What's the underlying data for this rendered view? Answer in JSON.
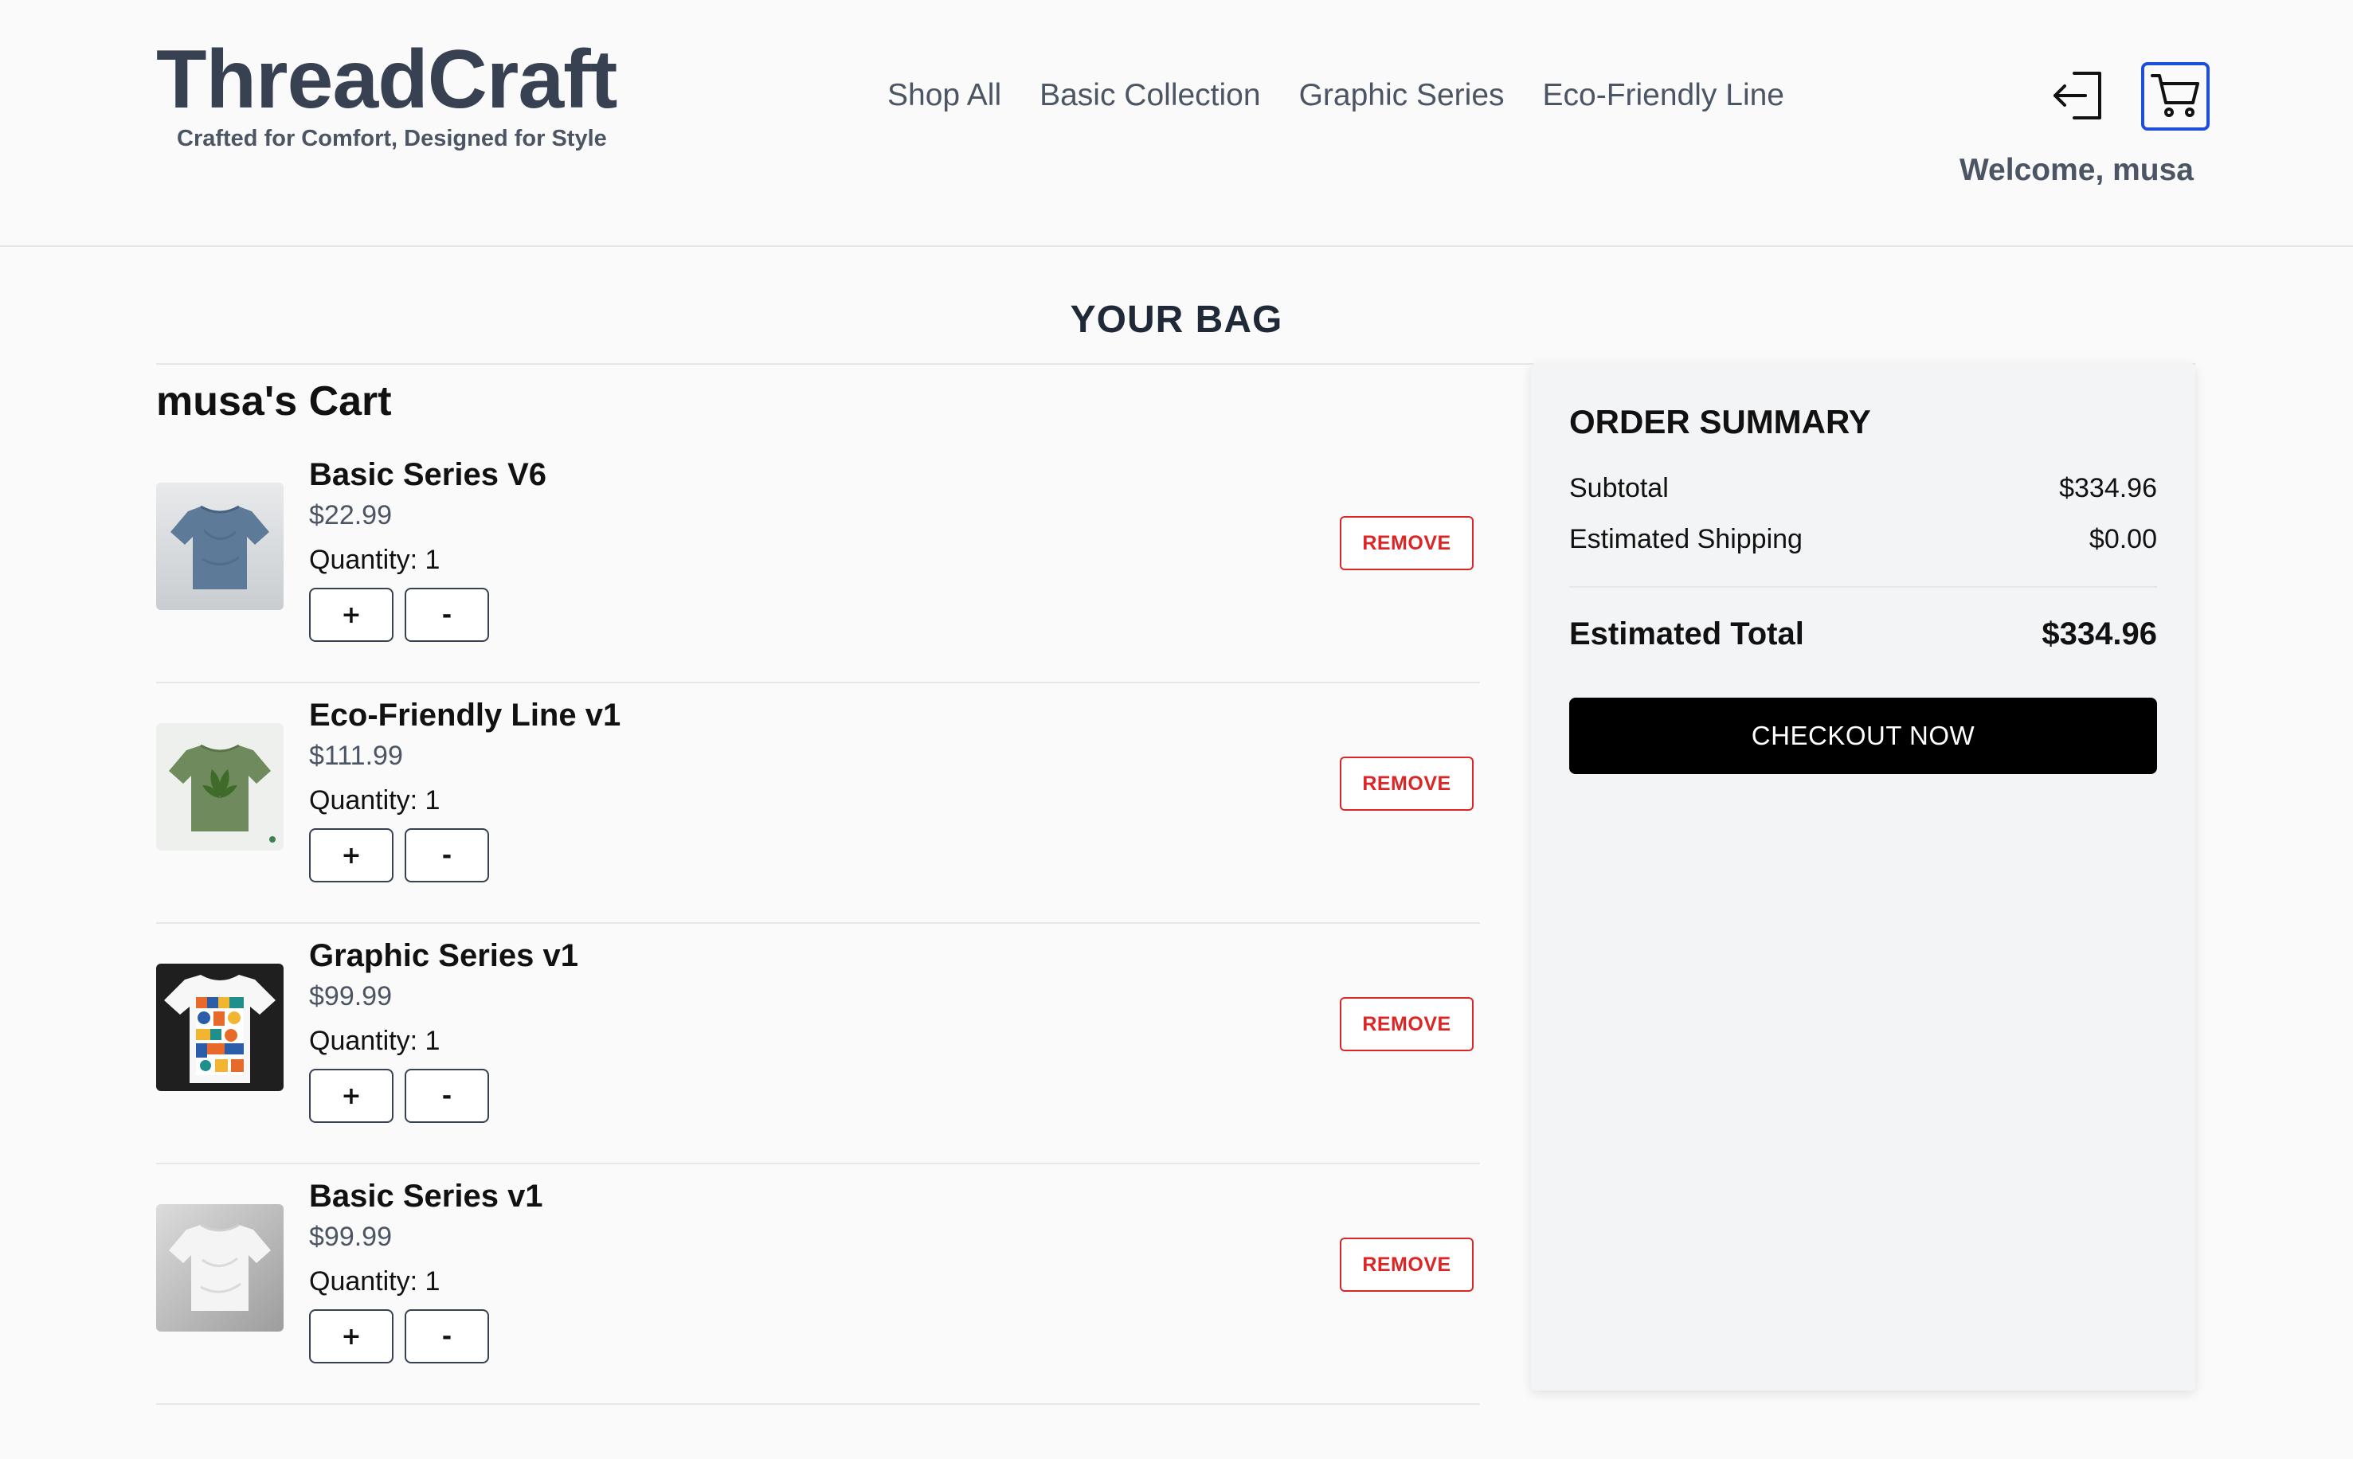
{
  "brand": {
    "title": "ThreadCraft",
    "tagline": "Crafted for Comfort, Designed for Style"
  },
  "nav": {
    "items": [
      {
        "label": "Shop All"
      },
      {
        "label": "Basic Collection"
      },
      {
        "label": "Graphic Series"
      },
      {
        "label": "Eco-Friendly Line"
      }
    ]
  },
  "header": {
    "welcome": "Welcome, musa",
    "logout_icon": "logout-icon",
    "cart_icon": "cart-icon",
    "accent_color": "#1d4ed8"
  },
  "page": {
    "heading": "YOUR BAG",
    "cart_title": "musa's Cart"
  },
  "cart": {
    "items": [
      {
        "name": "Basic Series V6",
        "price": "$22.99",
        "quantity_label": "Quantity: 1",
        "plus_label": "+",
        "minus_label": "-",
        "remove_label": "REMOVE",
        "image": "blue-tshirt-image"
      },
      {
        "name": "Eco-Friendly Line v1",
        "price": "$111.99",
        "quantity_label": "Quantity: 1",
        "plus_label": "+",
        "minus_label": "-",
        "remove_label": "REMOVE",
        "image": "green-leaf-tshirt-image"
      },
      {
        "name": "Graphic Series v1",
        "price": "$99.99",
        "quantity_label": "Quantity: 1",
        "plus_label": "+",
        "minus_label": "-",
        "remove_label": "REMOVE",
        "image": "graphic-print-tshirt-image"
      },
      {
        "name": "Basic Series v1",
        "price": "$99.99",
        "quantity_label": "Quantity: 1",
        "plus_label": "+",
        "minus_label": "-",
        "remove_label": "REMOVE",
        "image": "white-tshirt-image"
      }
    ],
    "remove_color": "#dc2626"
  },
  "summary": {
    "title": "ORDER SUMMARY",
    "subtotal_label": "Subtotal",
    "subtotal_value": "$334.96",
    "shipping_label": "Estimated Shipping",
    "shipping_value": "$0.00",
    "total_label": "Estimated Total",
    "total_value": "$334.96",
    "checkout_label": "CHECKOUT NOW"
  }
}
